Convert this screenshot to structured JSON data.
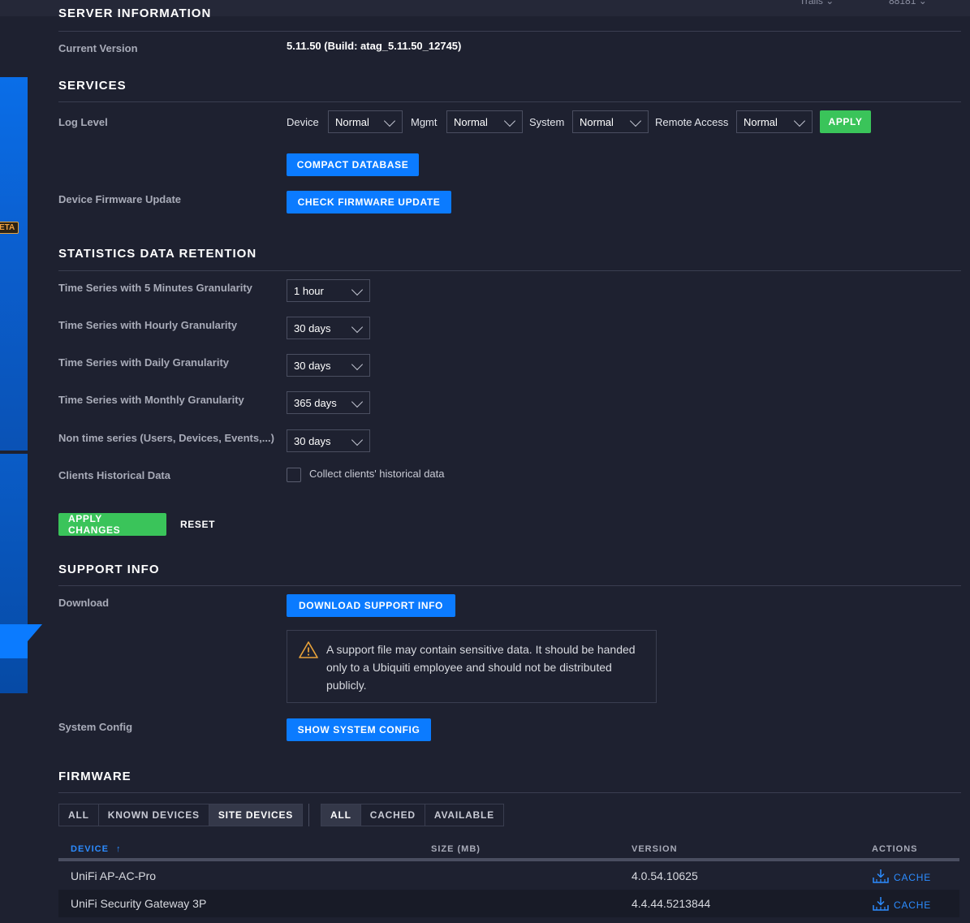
{
  "topbar": {
    "item1": "Trails",
    "item2": "88181"
  },
  "sidebar": {
    "beta_badge": "ETA"
  },
  "server_info": {
    "title": "SERVER INFORMATION",
    "current_version_label": "Current Version",
    "current_version_value": "5.11.50 (Build: atag_5.11.50_12745)"
  },
  "services": {
    "title": "SERVICES",
    "log_level_label": "Log Level",
    "device_label": "Device",
    "device_value": "Normal",
    "mgmt_label": "Mgmt",
    "mgmt_value": "Normal",
    "system_label": "System",
    "system_value": "Normal",
    "remote_label": "Remote Access",
    "remote_value": "Normal",
    "apply_label": "APPLY",
    "compact_db_label": "COMPACT DATABASE",
    "fw_update_label": "Device Firmware Update",
    "check_fw_label": "CHECK FIRMWARE UPDATE"
  },
  "stats": {
    "title": "STATISTICS DATA RETENTION",
    "rows": [
      {
        "label": "Time Series with 5 Minutes Granularity",
        "value": "1 hour"
      },
      {
        "label": "Time Series with Hourly Granularity",
        "value": "30 days"
      },
      {
        "label": "Time Series with Daily Granularity",
        "value": "30 days"
      },
      {
        "label": "Time Series with Monthly Granularity",
        "value": "365 days"
      },
      {
        "label": "Non time series (Users, Devices, Events,...)",
        "value": "30 days"
      }
    ],
    "clients_label": "Clients Historical Data",
    "clients_checkbox_label": "Collect clients' historical data",
    "clients_checked": false,
    "apply_changes_label": "APPLY CHANGES",
    "reset_label": "RESET"
  },
  "support": {
    "title": "SUPPORT INFO",
    "download_label": "Download",
    "download_button": "DOWNLOAD SUPPORT INFO",
    "warning_text": "A support file may contain sensitive data. It should be handed only to a Ubiquiti employee and should not be distributed publicly.",
    "system_config_label": "System Config",
    "system_config_button": "SHOW SYSTEM CONFIG"
  },
  "firmware": {
    "title": "FIRMWARE",
    "device_tabs": [
      "ALL",
      "KNOWN DEVICES",
      "SITE DEVICES"
    ],
    "device_tab_active": "SITE DEVICES",
    "status_tabs": [
      "ALL",
      "CACHED",
      "AVAILABLE"
    ],
    "status_tab_active": "ALL",
    "columns": {
      "device": "DEVICE",
      "size": "SIZE (MB)",
      "version": "VERSION",
      "actions": "ACTIONS"
    },
    "rows": [
      {
        "device": "UniFi AP-AC-Pro",
        "size": "",
        "version": "4.0.54.10625",
        "action": "CACHE"
      },
      {
        "device": "UniFi Security Gateway 3P",
        "size": "",
        "version": "4.4.44.5213844",
        "action": "CACHE"
      }
    ]
  },
  "colors": {
    "background": "#1e2130",
    "accent_blue": "#0b7bff",
    "accent_green": "#3ac45a",
    "warning": "#e8a23a"
  }
}
